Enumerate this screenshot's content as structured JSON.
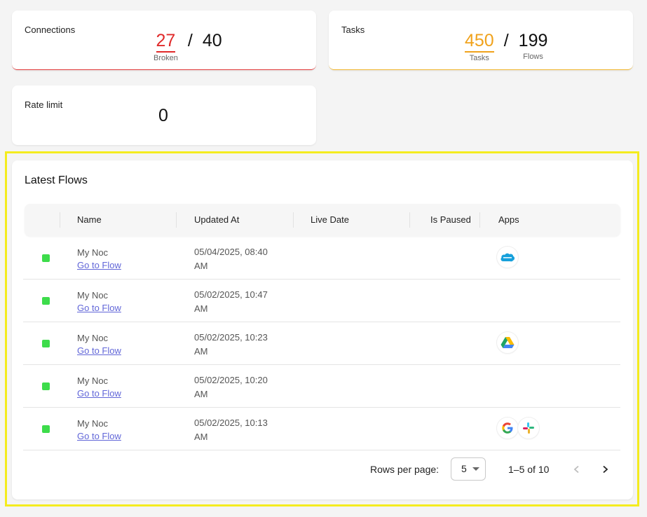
{
  "connections": {
    "title": "Connections",
    "broken": "27",
    "total": "40",
    "broken_label": "Broken",
    "slash": "/"
  },
  "tasks": {
    "title": "Tasks",
    "tasks": "450",
    "flows": "199",
    "tasks_label": "Tasks",
    "flows_label": "Flows",
    "slash": "/"
  },
  "rate_limit": {
    "title": "Rate limit",
    "value": "0"
  },
  "latest_flows": {
    "title": "Latest Flows",
    "columns": [
      "Name",
      "Updated At",
      "Live Date",
      "Is Paused",
      "Apps"
    ],
    "rows": [
      {
        "name": "My Noc",
        "link": "Go to Flow",
        "updated_line1": "05/04/2025, 08:40",
        "updated_line2": "AM",
        "apps": [
          "salesforce-icon"
        ]
      },
      {
        "name": "My Noc",
        "link": "Go to Flow",
        "updated_line1": "05/02/2025, 10:47",
        "updated_line2": "AM",
        "apps": []
      },
      {
        "name": "My Noc",
        "link": "Go to Flow",
        "updated_line1": "05/02/2025, 10:23",
        "updated_line2": "AM",
        "apps": [
          "google-drive-icon"
        ]
      },
      {
        "name": "My Noc",
        "link": "Go to Flow",
        "updated_line1": "05/02/2025, 10:20",
        "updated_line2": "AM",
        "apps": []
      },
      {
        "name": "My Noc",
        "link": "Go to Flow",
        "updated_line1": "05/02/2025, 10:13",
        "updated_line2": "AM",
        "apps": [
          "google-icon",
          "slack-icon"
        ]
      }
    ],
    "pagination": {
      "rows_per_page_label": "Rows per page:",
      "rows_per_page": "5",
      "range": "1–5 of 10"
    }
  },
  "colors": {
    "broken": "#e02a2a",
    "tasks": "#f0a21c",
    "status_active": "#3ddc4b",
    "link": "#6166d8",
    "highlight": "#f4ec1f"
  }
}
